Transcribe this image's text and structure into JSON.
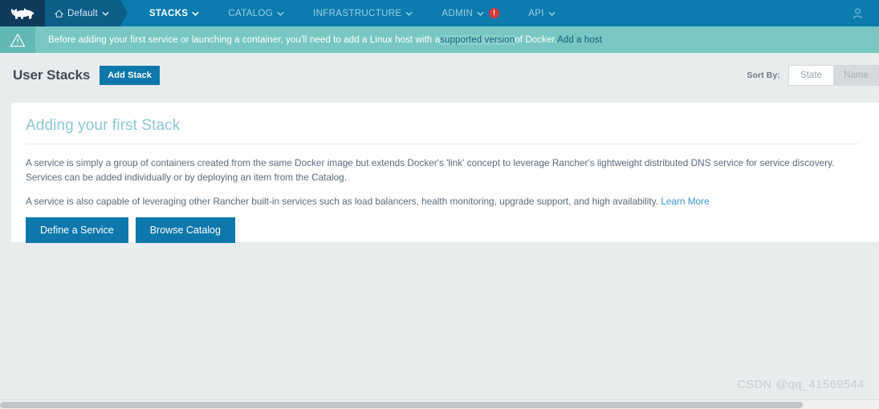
{
  "header": {
    "logo_alt": "rancher-logo",
    "environment": {
      "label": "Default",
      "icon": "home-icon",
      "caret": "⌄"
    },
    "nav_items": [
      {
        "label": "STACKS",
        "active": true,
        "caret": "⌄",
        "alert": ""
      },
      {
        "label": "CATALOG",
        "active": false,
        "caret": "⌄",
        "alert": ""
      },
      {
        "label": "INFRASTRUCTURE",
        "active": false,
        "caret": "⌄",
        "alert": ""
      },
      {
        "label": "ADMIN",
        "active": false,
        "caret": "⌄",
        "alert": "!"
      },
      {
        "label": "API",
        "active": false,
        "caret": "⌄",
        "alert": ""
      }
    ],
    "user_icon": "user-icon"
  },
  "banner": {
    "icon": "warning-triangle-icon",
    "text_before": "Before adding your first service or launching a container, you'll need to add a Linux host with a ",
    "link_supported": "supported version",
    "text_middle": " of Docker. ",
    "link_addhost": "Add a host"
  },
  "page": {
    "title": "User Stacks",
    "add_stack_label": "Add Stack",
    "sort_label": "Sort By:",
    "sort_options": [
      {
        "label": "State",
        "selected": true
      },
      {
        "label": "Name",
        "selected": false
      }
    ]
  },
  "card": {
    "title": "Adding your first Stack",
    "paragraph1": "A service is simply a group of containers created from the same Docker image but extends Docker's 'link' concept to leverage Rancher's lightweight distributed DNS service for service discovery. Services can be added individually or by deploying an item from the Catalog.",
    "paragraph2_before": "A service is also capable of leveraging other Rancher built-in services such as load balancers, health monitoring, upgrade support, and high availability. ",
    "paragraph2_link": "Learn More",
    "buttons": [
      {
        "label": "Define a Service"
      },
      {
        "label": "Browse Catalog"
      }
    ]
  },
  "watermark": {
    "text": "CSDN @qq_41569544"
  },
  "colors": {
    "nav_bg": "#0b7cad",
    "logo_bg": "#0e3a5c",
    "env_bg": "#0e5e8a",
    "banner_bg": "#78c7c3",
    "banner_icon_bg": "#62b8b4",
    "primary_button": "#0e77ab",
    "card_title": "#8cc8d4",
    "link": "#3c95c8",
    "alert_badge": "#d63c3c",
    "page_bg": "#e9ecec"
  }
}
